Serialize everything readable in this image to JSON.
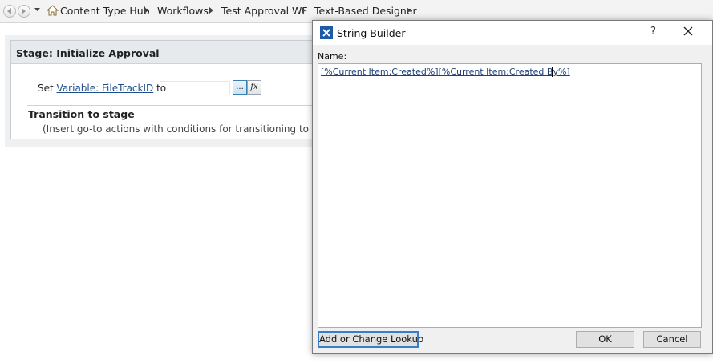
{
  "breadcrumb": {
    "items": [
      "Content Type Hub",
      "Workflows",
      "Test Approval WF",
      "Text-Based Designer"
    ]
  },
  "stage": {
    "title": "Stage: Initialize Approval",
    "set_prefix": "Set",
    "variable_link": "Variable: FileTrackID",
    "to_text": "to",
    "ellipsis_label": "...",
    "fx_label": "fx",
    "transition_title": "Transition to stage",
    "transition_note": "(Insert go-to actions with conditions for transitioning to the stage"
  },
  "dialog": {
    "title": "String Builder",
    "help": "?",
    "name_label": "Name:",
    "expression": "[%Current Item:Created%][%Current Item:Created By%]",
    "lookup_button": "Add or Change Lookup",
    "ok_button": "OK",
    "cancel_button": "Cancel"
  },
  "colors": {
    "link": "#1f4e8c",
    "accent": "#3b7dc8",
    "dialog_icon": "#1d5aa8"
  }
}
